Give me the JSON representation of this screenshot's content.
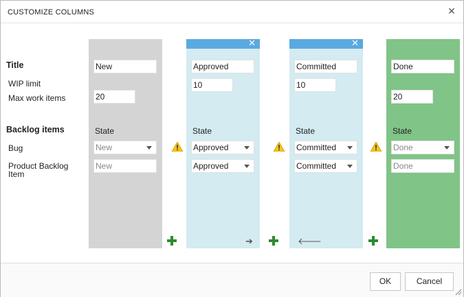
{
  "dialog": {
    "title": "CUSTOMIZE COLUMNS",
    "close_glyph": "✕"
  },
  "rows": {
    "title": "Title",
    "wip_limit": "WIP limit",
    "max_work_items": "Max work items",
    "backlog_items": "Backlog items",
    "bug": "Bug",
    "pbi_line1": "Product Backlog",
    "pbi_line2": "Item"
  },
  "columns": [
    {
      "name": "New",
      "style": "gray",
      "wip": "",
      "max": "20",
      "state_label": "State",
      "bug_state": "New",
      "pbi_state": "New",
      "editable": false
    },
    {
      "name": "Approved",
      "style": "blue",
      "wip": "10",
      "max": "",
      "state_label": "State",
      "bug_state": "Approved",
      "pbi_state": "Approved",
      "editable": true,
      "close_glyph": "✕",
      "move_glyph": "➔"
    },
    {
      "name": "Committed",
      "style": "blue",
      "wip": "10",
      "max": "",
      "state_label": "State",
      "bug_state": "Committed",
      "pbi_state": "Committed",
      "editable": true,
      "close_glyph": "✕",
      "move_glyph": "🡐"
    },
    {
      "name": "Done",
      "style": "green",
      "wip": "",
      "max": "20",
      "state_label": "State",
      "bug_state": "Done",
      "pbi_state": "Done",
      "editable": false
    }
  ],
  "colors": {
    "new_col": "#d4d4d4",
    "mid_col": "#d3ebf1",
    "done_col": "#80c487",
    "header": "#5aa9e0",
    "plus": "#2e8b2e",
    "warning": "#f5c518"
  },
  "footer": {
    "ok_label": "OK",
    "cancel_label": "Cancel"
  }
}
